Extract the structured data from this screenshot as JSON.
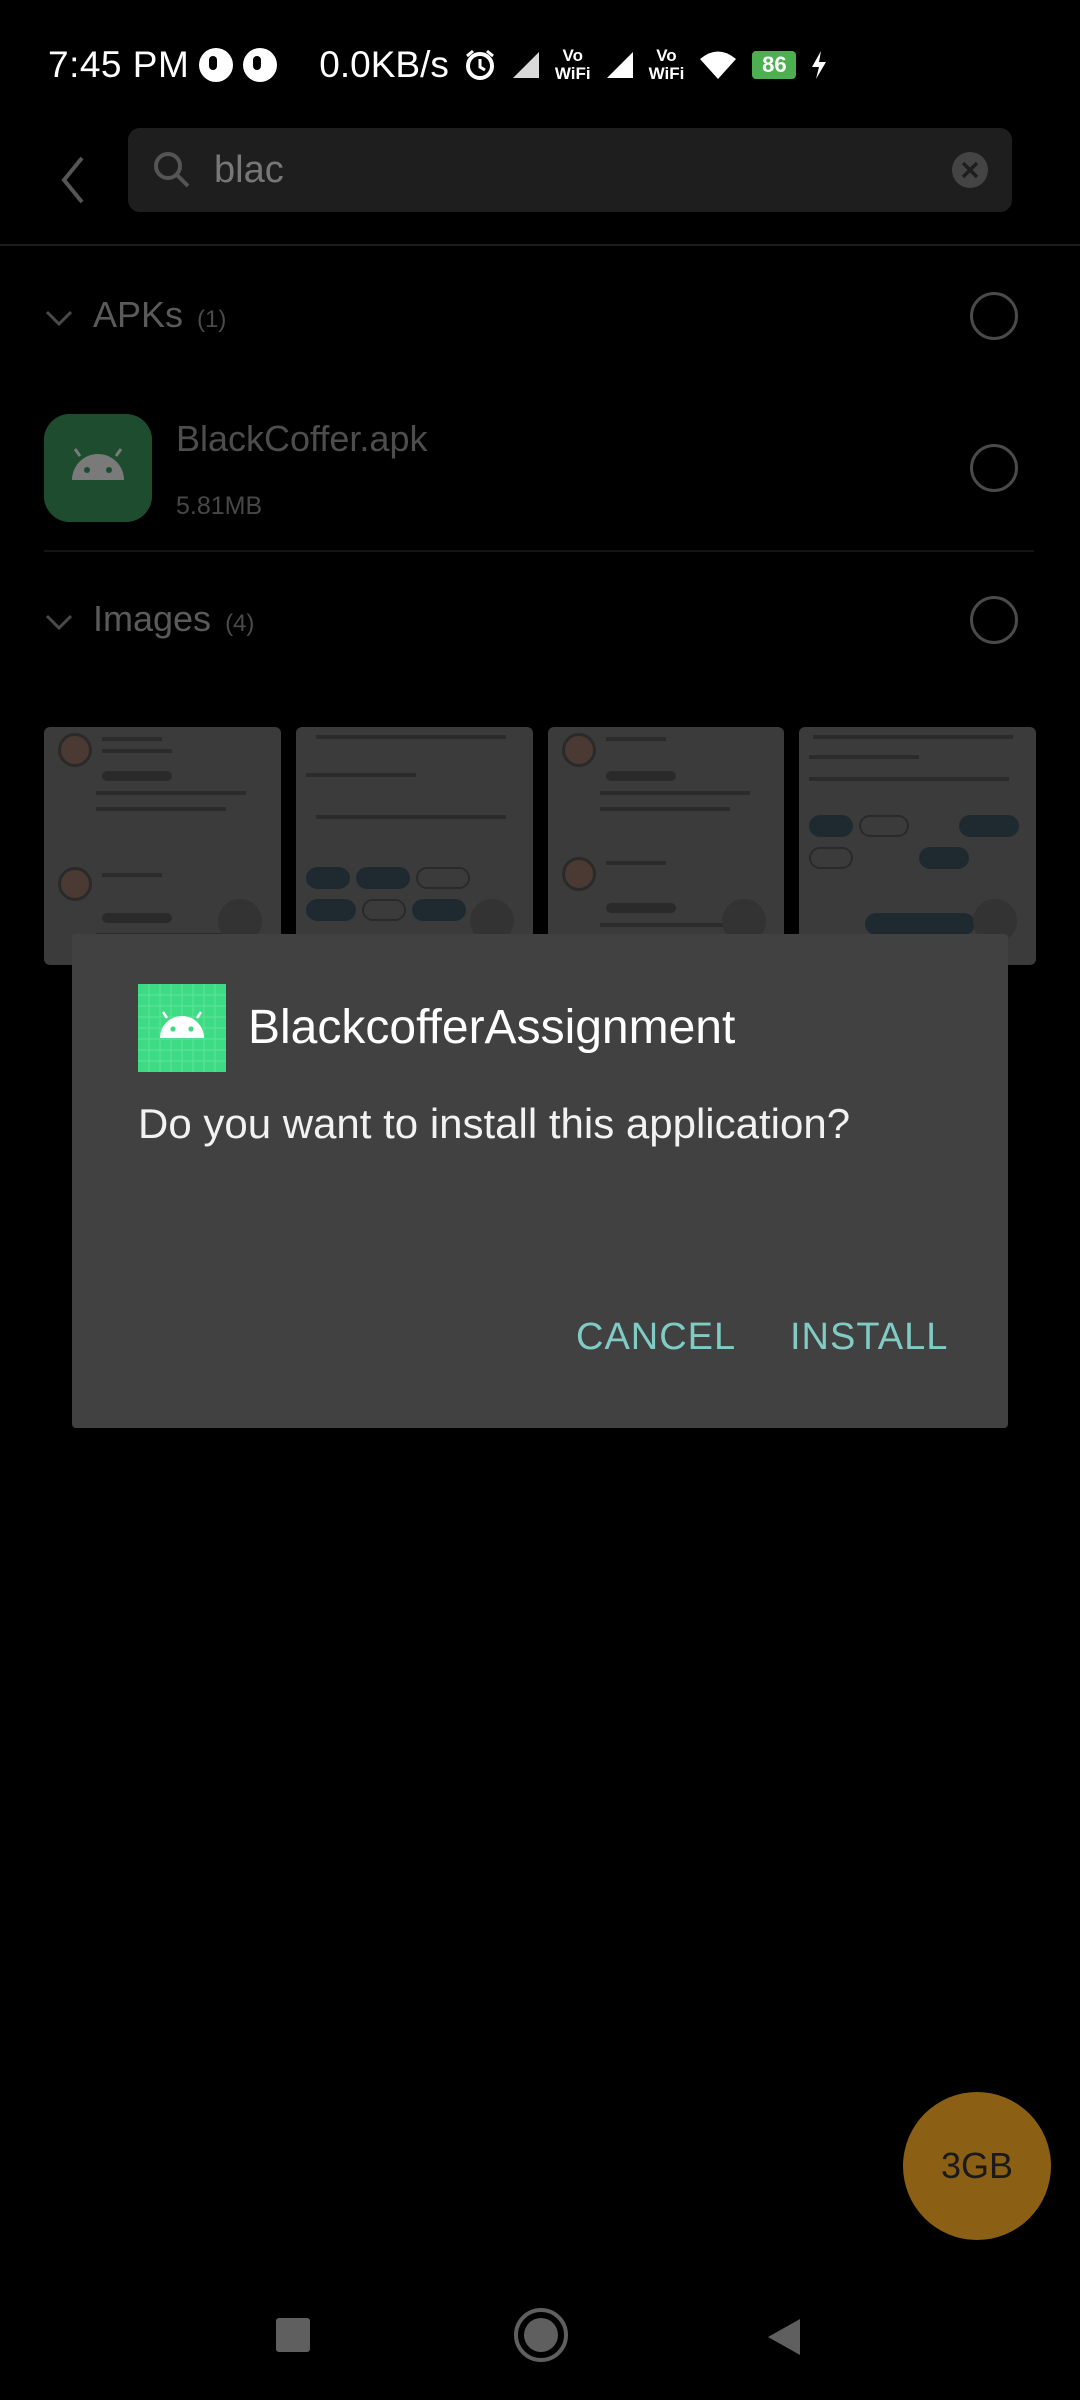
{
  "status_bar": {
    "time": "7:45 PM",
    "net_speed": "0.0KB/s",
    "vowifi_1_top": "Vo",
    "vowifi_1_bottom": "WiFi",
    "vowifi_2_top": "Vo",
    "vowifi_2_bottom": "WiFi",
    "battery": "86"
  },
  "search": {
    "query": "blac"
  },
  "sections": {
    "apks": {
      "title": "APKs",
      "count": "(1)"
    },
    "images": {
      "title": "Images",
      "count": "(4)"
    }
  },
  "apk_item": {
    "name": "BlackCoffer.apk",
    "size": "5.81MB"
  },
  "dialog": {
    "app_name": "BlackcofferAssignment",
    "message": "Do you want to install this application?",
    "cancel_label": "CANCEL",
    "install_label": "INSTALL"
  },
  "storage_fab": {
    "label": "3GB"
  },
  "colors": {
    "accent_button": "#80cbc4",
    "dialog_bg": "#414141",
    "android_green": "#3ddc84",
    "storage_fab": "#8c6014",
    "battery": "#4caf50"
  },
  "icons": [
    "back-arrow-icon",
    "search-icon",
    "clear-icon",
    "chevron-down-icon",
    "android-icon",
    "recents-icon",
    "home-icon",
    "back-icon",
    "alarm-icon",
    "signal-icon",
    "wifi-icon",
    "charging-icon"
  ]
}
